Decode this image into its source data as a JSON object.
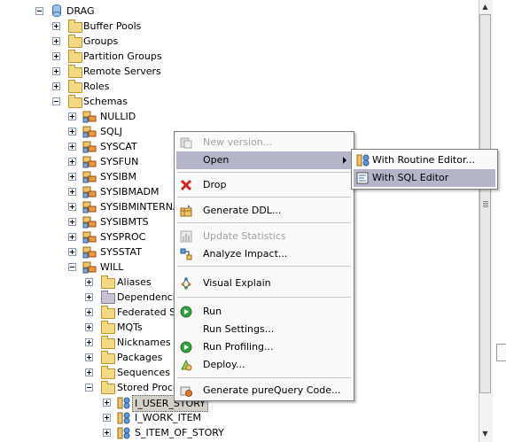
{
  "tree": {
    "root": "DRAG",
    "nodes": [
      "Buffer Pools",
      "Groups",
      "Partition Groups",
      "Remote Servers",
      "Roles",
      "Schemas"
    ],
    "schemas": [
      "NULLID",
      "SQLJ",
      "SYSCAT",
      "SYSFUN",
      "SYSIBM",
      "SYSIBMADM",
      "SYSIBMINTERNAL",
      "SYSIBMTS",
      "SYSPROC",
      "SYSSTAT",
      "WILL"
    ],
    "will_children": [
      "Aliases",
      "Dependencies",
      "Federated Stored Procedures",
      "MQTs",
      "Nicknames",
      "Packages",
      "Sequences",
      "Stored Procedures"
    ],
    "procedures": [
      "I_USER_STORY",
      "I_WORK_ITEM",
      "S_ITEM_OF_STORY"
    ]
  },
  "context_menu": {
    "items": {
      "new_version": "New version...",
      "open": "Open",
      "drop": "Drop",
      "generate_ddl": "Generate DDL...",
      "update_statistics": "Update Statistics",
      "analyze_impact": "Analyze Impact...",
      "visual_explain": "Visual Explain",
      "run": "Run",
      "run_settings": "Run Settings...",
      "run_profiling": "Run Profiling...",
      "deploy": "Deploy...",
      "generate_purequery": "Generate pureQuery Code..."
    }
  },
  "submenu": {
    "with_routine_editor": "With Routine Editor...",
    "with_sql_editor": "With SQL Editor"
  },
  "colors": {
    "highlight": "#b5b5ca",
    "folder": "#f4d884",
    "drop_red": "#d42020"
  }
}
